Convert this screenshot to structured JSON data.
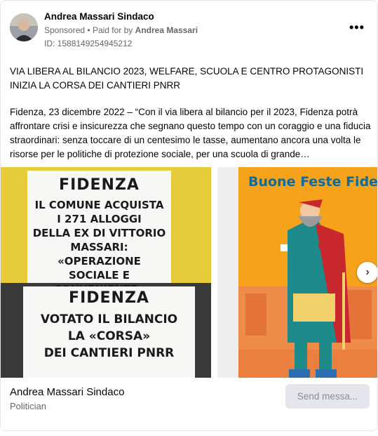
{
  "post": {
    "advertiser": "Andrea Massari Sindaco",
    "sponsored": "Sponsored",
    "paid_for_prefix": "Paid for by",
    "paid_for_name": "Andrea Massari",
    "ad_id": "ID: 1588149254945212",
    "more_label": "•••",
    "headline_line1": "VIA LIBERA AL BILANCIO 2023, WELFARE, SCUOLA E CENTRO PROTAGONISTI",
    "headline_line2": "INIZIA LA CORSA DEI CANTIERI PNRR",
    "body": "Fidenza, 23 dicembre 2022 – “Con il via libera al bilancio per il 2023, Fidenza potrà affrontare crisi e insicurezza che segnano questo tempo con un coraggio e una fiducia straordinari: senza toccare di un centesimo le tasse, aumentano ancora una volta le risorse per le politiche di protezione sociale, per una scuola di grande…"
  },
  "carousel": {
    "poster1": {
      "title": "FIDENZA",
      "lines": [
        "IL COMUNE ACQUISTA",
        "I 271 ALLOGGI",
        "DELLA EX DI VITTORIO",
        "MASSARI: «OPERAZIONE",
        "SOCIALE E CONVENIENTE»"
      ]
    },
    "poster2": {
      "title": "FIDENZA",
      "lines": [
        "VOTATO IL BILANCIO",
        "LA «CORSA»",
        "DEI CANTIERI PNRR"
      ]
    },
    "card3_text": "Buone Feste Fiden:",
    "next_icon": "chevron-right-icon"
  },
  "footer": {
    "page_name": "Andrea Massari Sindaco",
    "category": "Politician",
    "send_button": "Send messa..."
  }
}
